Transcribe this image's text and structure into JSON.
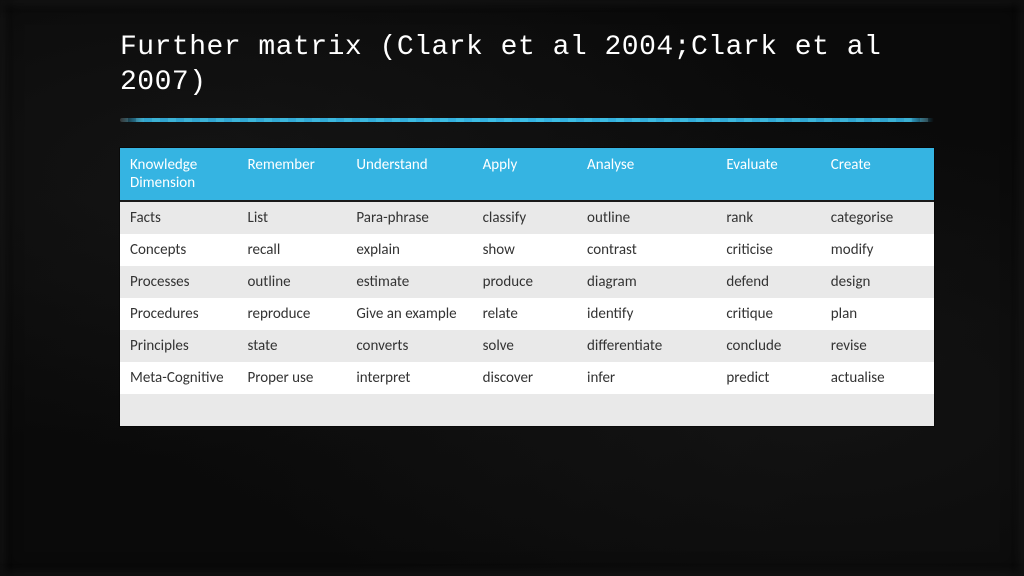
{
  "title": "Further matrix (Clark et al 2004;Clark et al 2007)",
  "chart_data": {
    "type": "table",
    "headers": [
      "Knowledge Dimension",
      "Remember",
      "Understand",
      "Apply",
      "Analyse",
      "Evaluate",
      "Create"
    ],
    "rows": [
      [
        "Facts",
        "List",
        "Para-phrase",
        "classify",
        "outline",
        "rank",
        "categorise"
      ],
      [
        "Concepts",
        "recall",
        "explain",
        "show",
        "contrast",
        "criticise",
        "modify"
      ],
      [
        "Processes",
        "outline",
        "estimate",
        "produce",
        "diagram",
        "defend",
        "design"
      ],
      [
        "Procedures",
        "reproduce",
        "Give an example",
        "relate",
        "identify",
        "critique",
        "plan"
      ],
      [
        "Principles",
        "state",
        "converts",
        "solve",
        "differentiate",
        "conclude",
        "revise"
      ],
      [
        "Meta-Cognitive",
        "Proper use",
        "interpret",
        "discover",
        "infer",
        "predict",
        "actualise"
      ],
      [
        "",
        "",
        "",
        "",
        "",
        "",
        ""
      ]
    ]
  }
}
